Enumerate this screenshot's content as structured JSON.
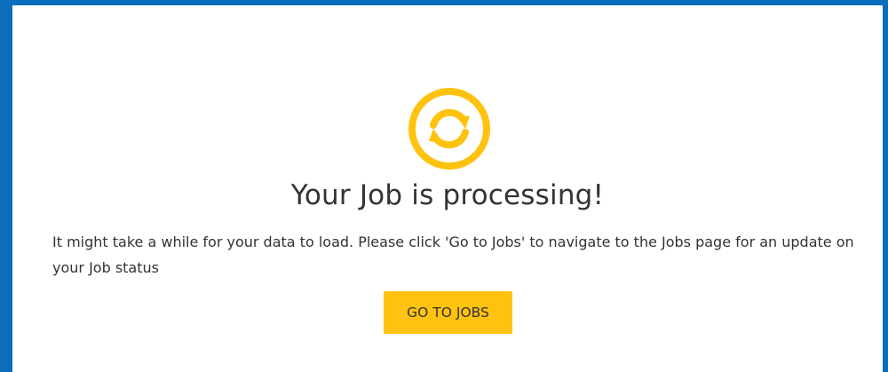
{
  "status": {
    "icon": "sync-icon",
    "icon_color": "#ffc20e",
    "title": "Your Job is processing!",
    "message": "It might take a while for your data to load. Please click 'Go to Jobs' to navigate to the Jobs page for an update on your Job status"
  },
  "actions": {
    "go_to_jobs_label": "GO TO JOBS",
    "button_color": "#ffc20e"
  },
  "theme": {
    "frame_border_color": "#0a6ebd",
    "text_color": "#333333"
  }
}
